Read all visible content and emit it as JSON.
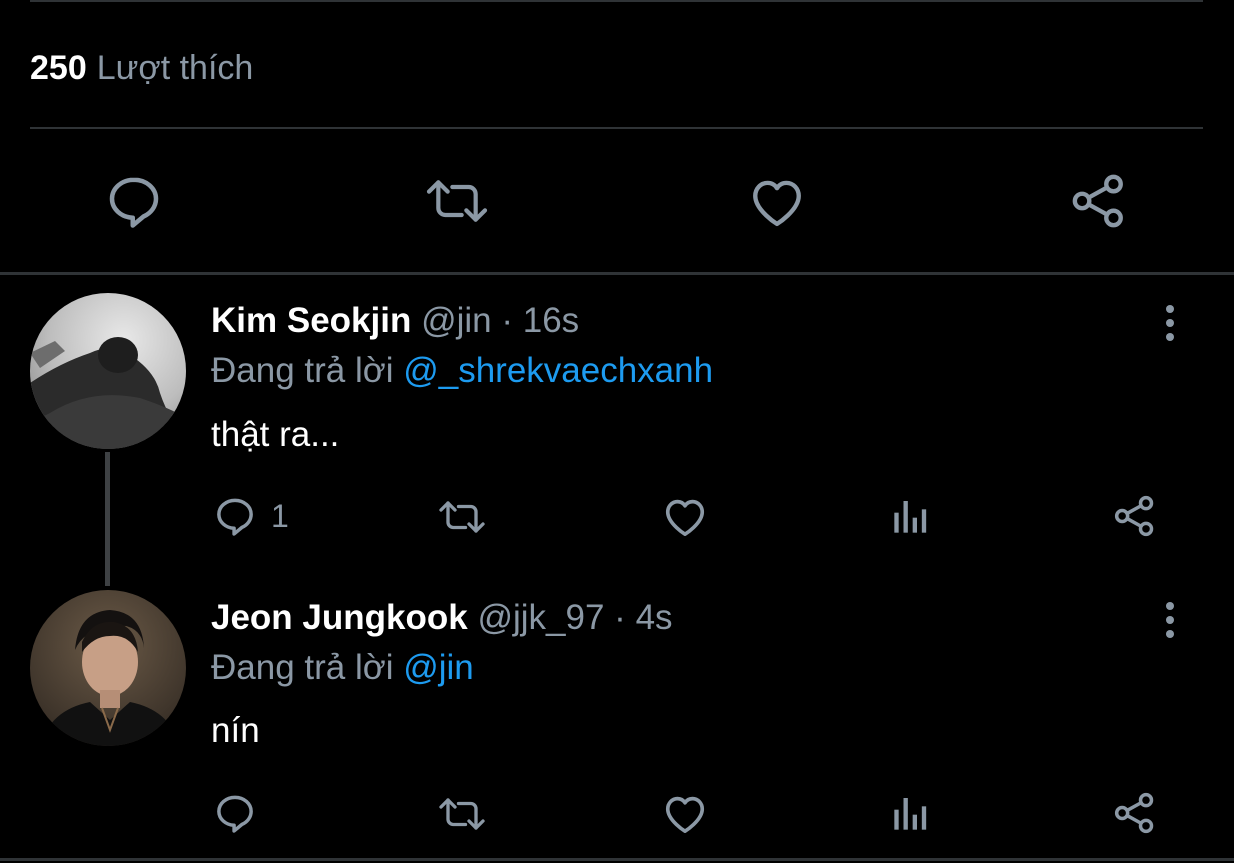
{
  "stats": {
    "likes_count": "250",
    "likes_label": "Lượt thích"
  },
  "main_actions": {
    "icons": [
      "reply-icon",
      "retweet-icon",
      "like-icon",
      "share-icon"
    ]
  },
  "replies": [
    {
      "name": "Kim Seokjin",
      "handle": "@jin",
      "dot": "·",
      "time": "16s",
      "replying_prefix": "Đang trả lời",
      "replying_to": "@_shrekvaechxanh",
      "text": "thật ra...",
      "reply_count": "1"
    },
    {
      "name": "Jeon Jungkook",
      "handle": "@jjk_97",
      "dot": "·",
      "time": "4s",
      "replying_prefix": "Đang trả lời",
      "replying_to": "@jin",
      "text": "nín",
      "reply_count": ""
    }
  ],
  "colors": {
    "background": "#000000",
    "secondary_text": "#8b98a5",
    "mention": "#1d9bf0",
    "divider": "#2f3336"
  }
}
